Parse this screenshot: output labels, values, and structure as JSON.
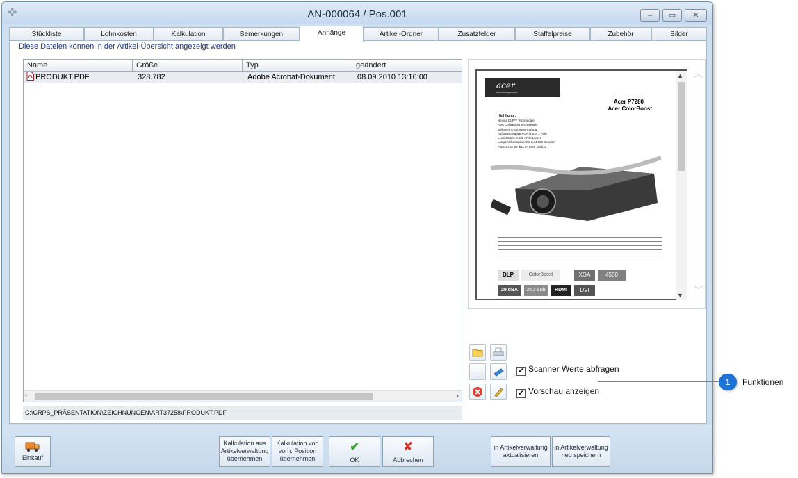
{
  "window": {
    "title": "AN-000064 / Pos.001"
  },
  "tabs": [
    {
      "label": "Stückliste"
    },
    {
      "label": "Lohnkosten"
    },
    {
      "label": "Kalkulation"
    },
    {
      "label": "Bemerkungen"
    },
    {
      "label": "Anhänge"
    },
    {
      "label": "Artikel-Ordner"
    },
    {
      "label": "Zusatzfelder"
    },
    {
      "label": "Staffelpreise"
    },
    {
      "label": "Zubehör"
    },
    {
      "label": "Bilder"
    }
  ],
  "info_text": "Diese Dateien können in der Artikel-Übersicht angezeigt werden",
  "table": {
    "columns": [
      "Name",
      "Größe",
      "Typ",
      "geändert"
    ],
    "rows": [
      {
        "name": "PRODUKT.PDF",
        "size": "328.782",
        "type": "Adobe Acrobat-Dokument",
        "changed": "08.09.2010 13:16:00"
      }
    ]
  },
  "file_path": "C:\\CRPS_PRÄSENTATION\\ZEICHNUNGEN\\ART37258\\PRODUKT.PDF",
  "preview": {
    "brand": "acer",
    "slogan": "Empowering People",
    "model": "Acer P7280",
    "tech": "Acer ColorBoost",
    "highlights_title": "Highlights:",
    "highlights": [
      "Neuste DLP™ Technologie",
      "Acer ColorBoost Technologie",
      "Brillantes 6 Segment-Farbrad",
      "Auflösung Native XGA (1.024 x 768)",
      "Leuchtstärke 4.500 ANSI Lumen",
      "Lampenlebensdauer bis zu 4.000 Stunden",
      "Flüsterleise 29 dBA im ECO-Modus"
    ],
    "badges": [
      "DLP",
      "ColorBoost",
      "XGA",
      "4500",
      "29 dBA",
      "2xD-Sub",
      "HDMI",
      "DVI"
    ]
  },
  "options": {
    "scanner_label": "Scanner Werte abfragen",
    "preview_label": "Vorschau anzeigen",
    "scanner_checked": "✔",
    "preview_checked": "✔"
  },
  "footer": {
    "einkauf": "Einkauf",
    "kalk_aus_line1": "Kalkulation aus",
    "kalk_aus_line2": "Artikelverwaltung",
    "kalk_aus_line3": "übernehmen",
    "kalk_von_line1": "Kalkulation von",
    "kalk_von_line2": "vorh. Position",
    "kalk_von_line3": "übernehmen",
    "ok": "OK",
    "abbrechen": "Abbrechen",
    "artikel_akt_line1": "in Artikelverwaltung",
    "artikel_akt_line2": "aktualisieren",
    "artikel_neu_line1": "in Artikelverwaltung",
    "artikel_neu_line2": "neu speichern"
  },
  "callout": {
    "number": "1",
    "label": "Funktionen"
  }
}
